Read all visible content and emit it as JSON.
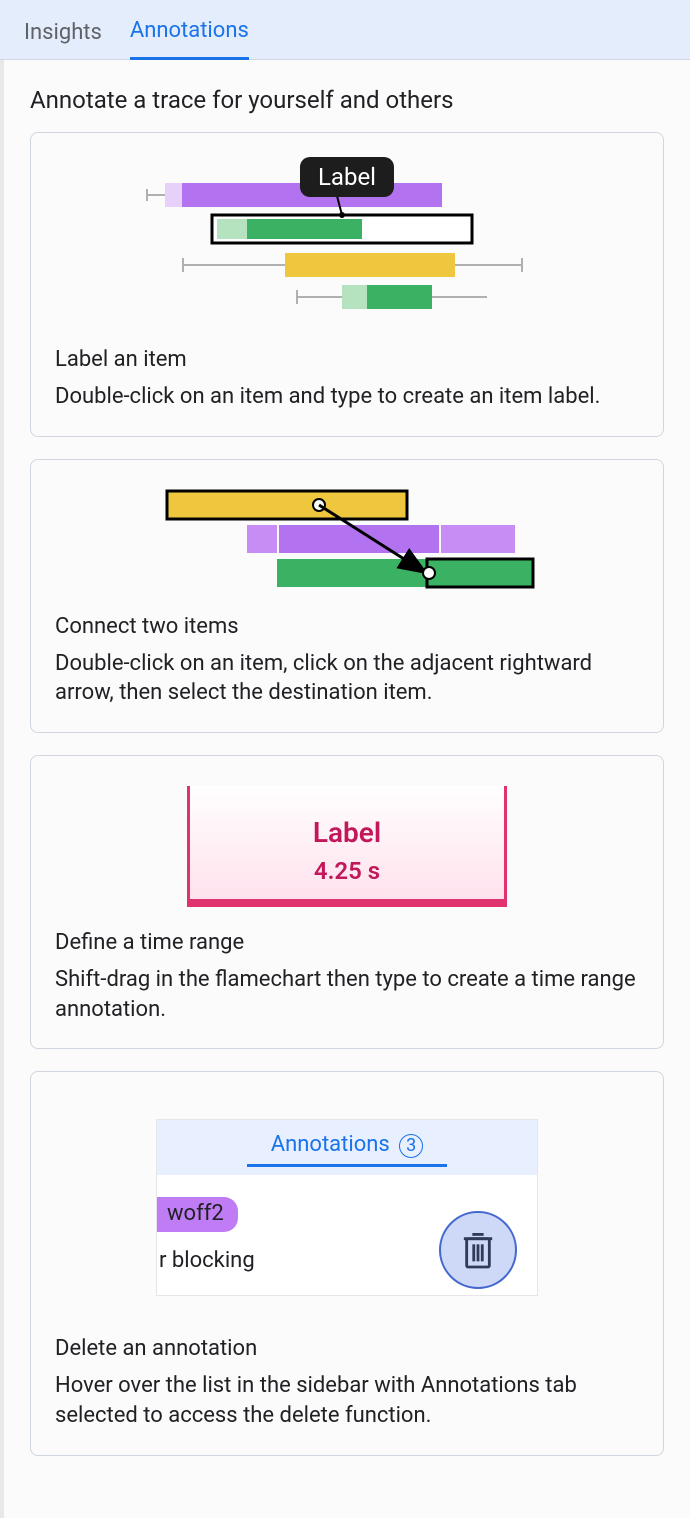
{
  "tabs": {
    "insights": "Insights",
    "annotations": "Annotations"
  },
  "page_title": "Annotate a trace for yourself and others",
  "cards": {
    "label_item": {
      "tooltip": "Label",
      "title": "Label an item",
      "desc": "Double-click on an item and type to create an item label."
    },
    "connect": {
      "title": "Connect two items",
      "desc": "Double-click on an item, click on the adjacent rightward arrow, then select the destination item."
    },
    "time_range": {
      "range_label": "Label",
      "range_time": "4.25 s",
      "title": "Define a time range",
      "desc": "Shift-drag in the flamechart then type to create a time range annotation."
    },
    "delete": {
      "panel_title": "Annotations",
      "panel_count": "3",
      "pill": "woff2",
      "blocking": "r blocking",
      "title": "Delete an annotation",
      "desc": "Hover over the list in the sidebar with Annotations tab selected to access the delete function."
    }
  }
}
